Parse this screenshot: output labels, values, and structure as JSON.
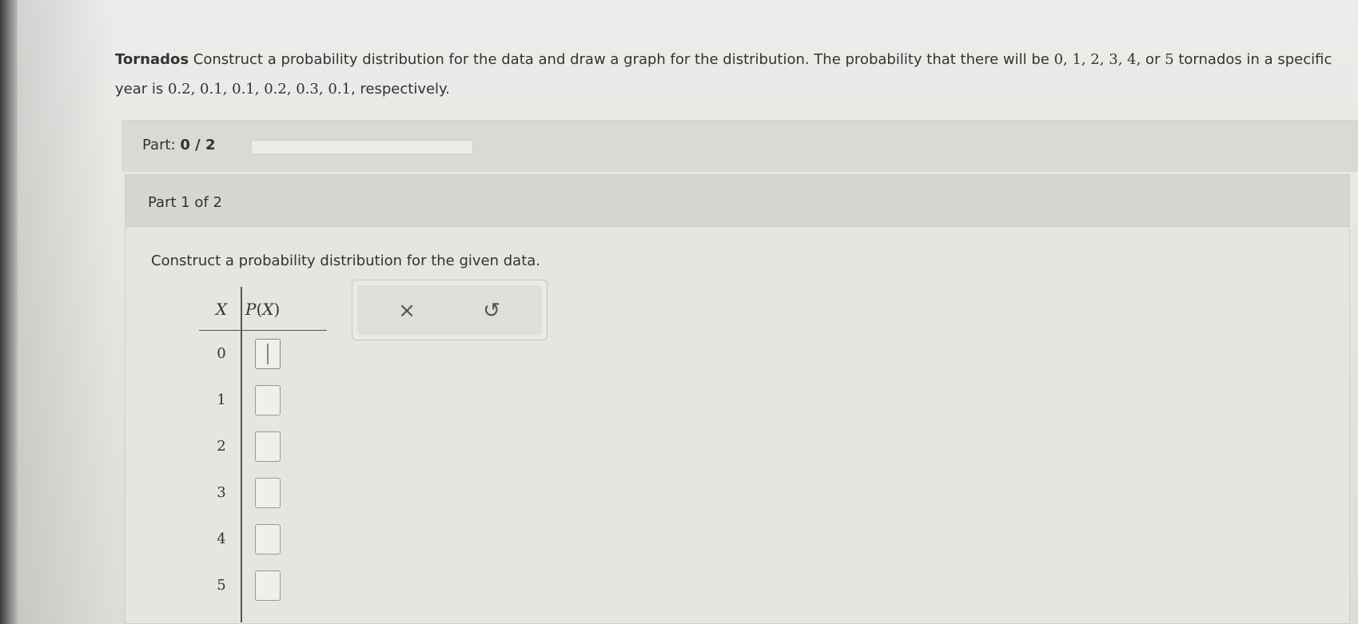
{
  "problem": {
    "lead": "Tornados",
    "text_a": " Construct a probability distribution for the data and draw a graph for the distribution. The probability that there will be ",
    "counts": "0, 1, 2, 3, 4,",
    "text_b": " or ",
    "last_count": "5",
    "text_c": " tornados in a specific year is ",
    "probabilities": "0.2, 0.1, 0.1, 0.2, 0.3, 0.1",
    "text_d": ", respectively."
  },
  "progress": {
    "label": "Part:",
    "value": "0 / 2",
    "fraction": 0
  },
  "panel": {
    "title": "Part 1 of 2",
    "instruction": "Construct a probability distribution for the given data."
  },
  "table": {
    "header_x": "X",
    "header_p_prefix": "P",
    "header_p_open": "(",
    "header_p_var": "X",
    "header_p_close": ")",
    "rows": [
      {
        "x": "0"
      },
      {
        "x": "1"
      },
      {
        "x": "2"
      },
      {
        "x": "3"
      },
      {
        "x": "4"
      },
      {
        "x": "5"
      }
    ]
  },
  "tools": {
    "clear_symbol": "×",
    "undo_symbol": "↺"
  }
}
